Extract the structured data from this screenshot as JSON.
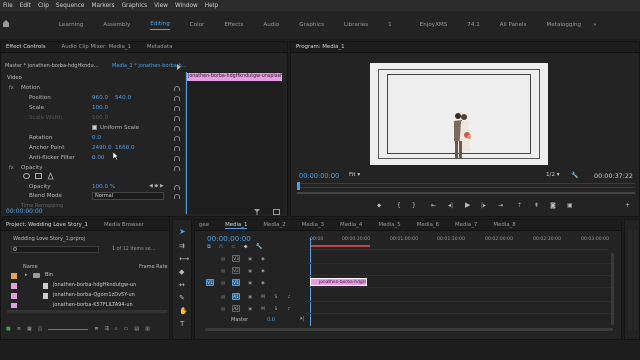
{
  "menu": [
    "File",
    "Edit",
    "Clip",
    "Sequence",
    "Markers",
    "Graphics",
    "View",
    "Window",
    "Help"
  ],
  "workspace": {
    "tabs": [
      "Learning",
      "Assembly",
      "Editing",
      "Color",
      "Effects",
      "Audio",
      "Graphics",
      "Libraries",
      "1",
      "EnjoyXMS",
      "74.1",
      "All Panels",
      "Metalogging"
    ],
    "active": "Editing",
    "more": "»"
  },
  "effect_controls": {
    "tabs": [
      "Effect Controls",
      "Audio Clip Mixer: Media_1",
      "Metadata"
    ],
    "header_source": "Master * jonathen-borba-hdgHkndu...",
    "header_seq": "Media_1 * jonathen-borba-h...",
    "clip_label": "jonathen-borba-hdgHkndutgw-unsplash",
    "section": "Video",
    "motion": "Motion",
    "position_label": "Position",
    "position_x": "960.0",
    "position_y": "540.0",
    "scale_label": "Scale",
    "scale_val": "100.0",
    "scale_width_label": "Scale Width",
    "scale_width_val": "100.0",
    "uniform_label": "Uniform Scale",
    "rotation_label": "Rotation",
    "rotation_val": "0.0",
    "anchor_label": "Anchor Point",
    "anchor_x": "2490.0",
    "anchor_y": "1660.0",
    "flicker_label": "Anti-flicker Filter",
    "flicker_val": "0.00",
    "opacity_section": "Opacity",
    "opacity_label": "Opacity",
    "opacity_val": "100.0 %",
    "blend_label": "Blend Mode",
    "blend_val": "Normal",
    "time_remap": "Time Remapping",
    "timecode": "00:00:00:00"
  },
  "program": {
    "title": "Program: Media_1",
    "timecode": "00:00:00:00",
    "fit": "Fit",
    "quality": "1/2",
    "duration": "00:00:37:22"
  },
  "project": {
    "tabs": [
      "Project: Wedding Love Story_1",
      "Media Browser"
    ],
    "file": "Wedding Love Story_1.prproj",
    "count": "1 of 12 items se...",
    "col_name": "Name",
    "col_rate": "Frame Rate",
    "items": [
      "Bin",
      "jonathen-borba-hdgHkndutgw-un",
      "jonathen-borba-Qgom1zDv5Y-un",
      "jonathen-borba-K57FLILTA94-un"
    ]
  },
  "timeline": {
    "tabs": [
      "gee",
      "Media_1",
      "Media_2",
      "Media_3",
      "Media_4",
      "Media_5",
      "Media_6",
      "Media_7",
      "Media_8"
    ],
    "timecode": "00:00:00:00",
    "ruler": [
      "00:00",
      "00:00:30:00",
      "00:01:00:00",
      "00:01:30:00",
      "00:02:00:00",
      "00:02:30:00",
      "00:03:00:00"
    ],
    "tracks": [
      "V3",
      "V2",
      "V1",
      "A1",
      "A2"
    ],
    "master": "Master",
    "master_val": "0.0",
    "clip": "jonathen-borba-hdgH"
  }
}
